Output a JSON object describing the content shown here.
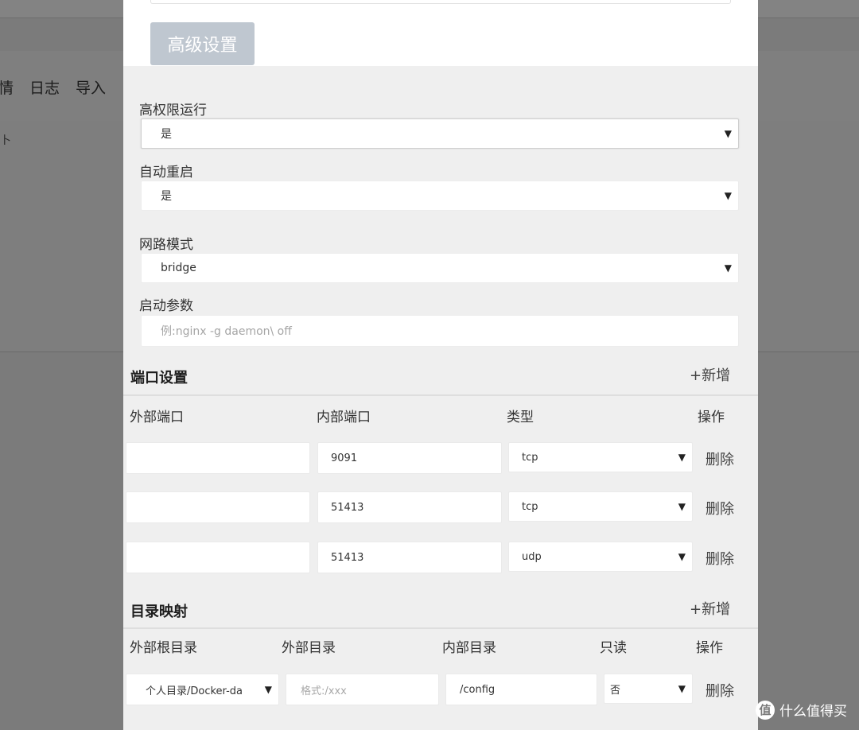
{
  "background_page": {
    "nav_items": [
      "情",
      "日志",
      "导入"
    ],
    "fragment": "卜"
  },
  "modal": {
    "advanced_button": "高级设置",
    "privileged": {
      "label": "高权限运行",
      "value": "是"
    },
    "auto_restart": {
      "label": "自动重启",
      "value": "是"
    },
    "network_mode": {
      "label": "网路模式",
      "value": "bridge"
    },
    "start_params": {
      "label": "启动参数",
      "placeholder": "例:nginx -g daemon\\ off"
    },
    "port_section": {
      "title": "端口设置",
      "add": "+新增",
      "headers": [
        "外部端口",
        "内部端口",
        "类型",
        "操作"
      ],
      "rows": [
        {
          "external": "",
          "internal": "9091",
          "type": "tcp",
          "action": "删除"
        },
        {
          "external": "",
          "internal": "51413",
          "type": "tcp",
          "action": "删除"
        },
        {
          "external": "",
          "internal": "51413",
          "type": "udp",
          "action": "删除"
        }
      ]
    },
    "dir_section": {
      "title": "目录映射",
      "add": "+新增",
      "headers": [
        "外部根目录",
        "外部目录",
        "内部目录",
        "只读",
        "操作"
      ],
      "rows": [
        {
          "root": "个人目录/Docker-da",
          "external_placeholder": "格式:/xxx",
          "internal": "/config",
          "readonly": "否",
          "action": "删除"
        }
      ]
    }
  },
  "watermark": {
    "logo": "值",
    "text": "什么值得买"
  },
  "icons": {
    "dropdown": "dropdown-arrow-icon"
  }
}
